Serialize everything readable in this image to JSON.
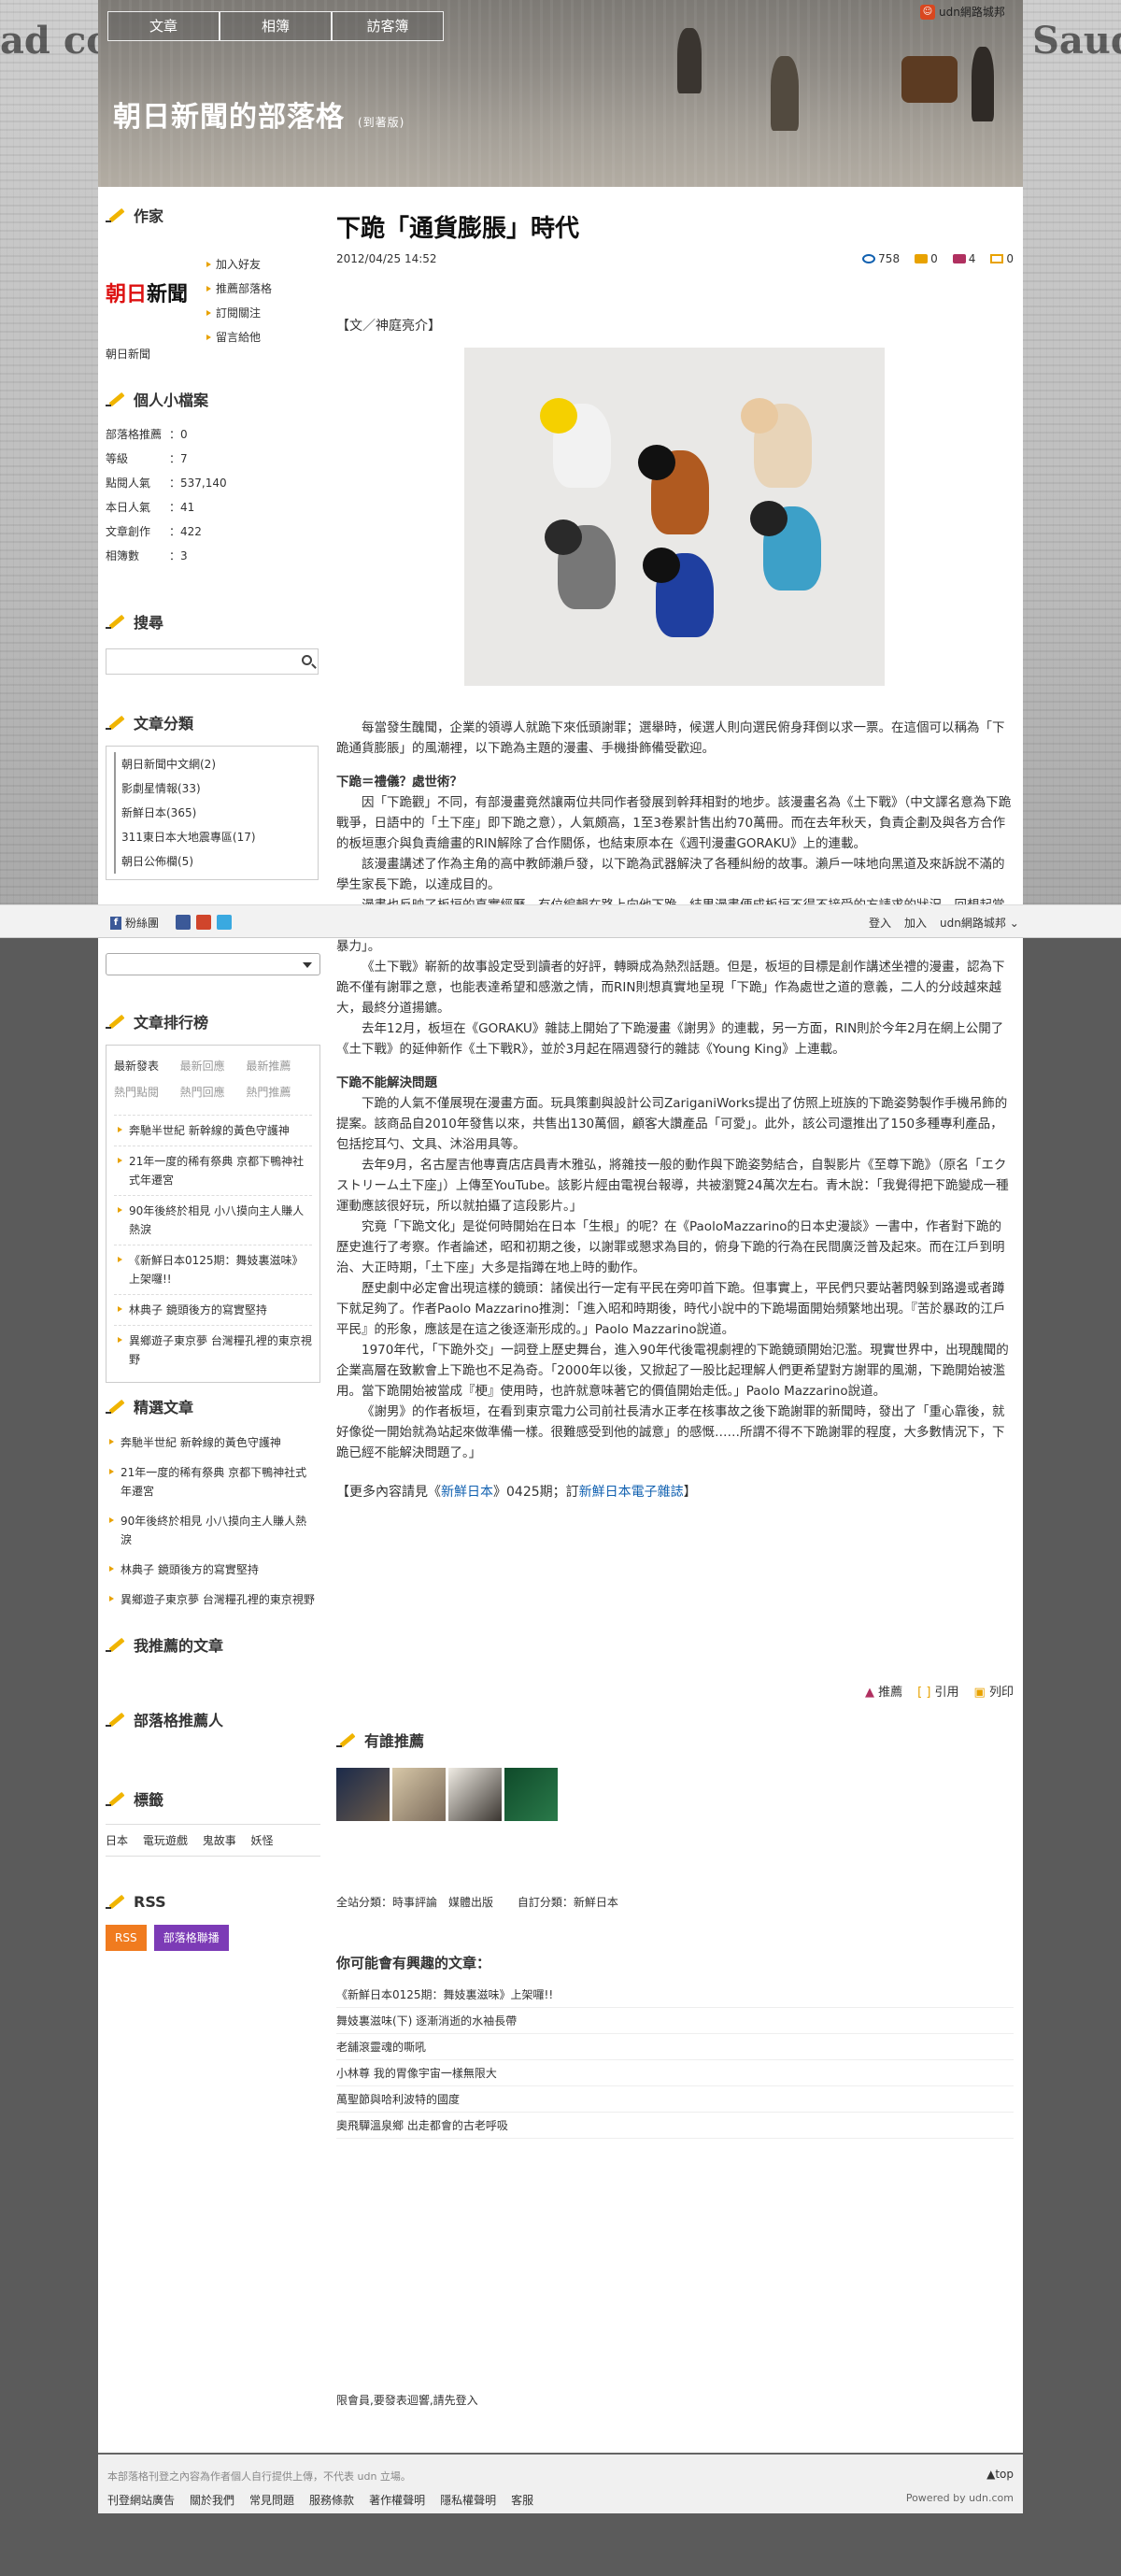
{
  "nav": {
    "tabs": [
      "文章",
      "相簿",
      "訪客簿"
    ]
  },
  "udn_link": "udn網路城邦",
  "blog": {
    "title": "朝日新聞的部落格",
    "badge": "(到著版)"
  },
  "author": {
    "section": "作家",
    "logo_red": "朝日",
    "logo_black": "新聞",
    "name": "朝日新聞",
    "links": [
      "加入好友",
      "推薦部落格",
      "訂閱關注",
      "留言給他"
    ]
  },
  "profile": {
    "section": "個人小檔案",
    "rows": [
      {
        "k": "部落格推薦",
        "v": "0"
      },
      {
        "k": "等級",
        "v": "7"
      },
      {
        "k": "點閱人氣",
        "v": "537,140"
      },
      {
        "k": "本日人氣",
        "v": "41"
      },
      {
        "k": "文章創作",
        "v": "422"
      },
      {
        "k": "相簿數",
        "v": "3"
      }
    ]
  },
  "search": {
    "section": "搜尋"
  },
  "categories": {
    "section": "文章分類",
    "items": [
      "朝日新聞中文網(2)",
      "影劇星情報(33)",
      "新鮮日本(365)",
      "311東日本大地震專區(17)",
      "朝日公佈欄(5)"
    ]
  },
  "ranking": {
    "section": "文章排行榜",
    "tabs_row1": [
      "最新發表",
      "最新回應",
      "最新推薦"
    ],
    "tabs_row2": [
      "熱門點閱",
      "熱門回應",
      "熱門推薦"
    ],
    "items": [
      "奔馳半世紀 新幹線的黃色守護神",
      "21年一度的稀有祭典 京都下鴨神社式年遷宮",
      "90年後終於相見 小八摸向主人賺人熱淚",
      "《新鮮日本0125期：舞妓裏滋味》上架囉!!",
      "林典子 鏡頭後方的寫實堅持",
      "異鄉遊子東京夢 台灣糧孔裡的東京視野"
    ]
  },
  "picks": {
    "section": "精選文章",
    "items": [
      "奔馳半世紀 新幹線的黃色守護神",
      "21年一度的稀有祭典 京都下鴨神社式年遷宮",
      "90年後終於相見 小八摸向主人賺人熱淚",
      "林典子 鏡頭後方的寫實堅持",
      "異鄉遊子東京夢 台灣糧孔裡的東京視野"
    ]
  },
  "my_reco": {
    "section": "我推薦的文章"
  },
  "blog_reco": {
    "section": "部落格推薦人"
  },
  "tags": {
    "section": "標籤",
    "items": [
      "日本",
      "電玩遊戲",
      "鬼故事",
      "妖怪"
    ]
  },
  "rss": {
    "section": "RSS",
    "btn1": "RSS",
    "btn2": "部落格聯播"
  },
  "post": {
    "title": "下跪「通貨膨脹」時代",
    "date": "2012/04/25 14:52",
    "views": "758",
    "comments": "0",
    "recommends": "4",
    "quotes": "0",
    "credit": "【文／神庭亮介】",
    "paragraphs": [
      {
        "type": "p",
        "text": "每當發生醜聞，企業的領導人就跪下來低頭謝罪；選舉時，候選人則向選民俯身拜倒以求一票。在這個可以稱為「下跪通貨膨脹」的風潮裡，以下跪為主題的漫畫、手機掛飾備受歡迎。"
      },
      {
        "type": "sub",
        "text": "下跪＝禮儀？處世術？"
      },
      {
        "type": "p",
        "text": "因「下跪觀」不同，有部漫畫竟然讓兩位共同作者發展到幹拜相對的地步。該漫畫名為《土下戰》（中文譯名意為下跪戰爭，日語中的「土下座」即下跪之意），人氣頗高，1至3卷累計售出約70萬冊。而在去年秋天，負責企劃及與各方合作的板垣惠介與負責繪畫的RIN解除了合作關係，也結束原本在《週刊漫畫GORAKU》上的連載。"
      },
      {
        "type": "p",
        "text": "該漫畫講述了作為主角的高中教師瀨戶發，以下跪為武器解決了各種糾紛的故事。瀨戶一味地向黑道及來訴說不滿的學生家長下跪，以達成目的。"
      },
      {
        "type": "p",
        "text": "漫畫也反映了板垣的真實經歷。有位編輯在路上向他下跪，結果漫畫便成板垣不得不接受的方請求的狀況。回想起當時的情景，板垣說：「周圍的人都用『哎呀你就答應他吧』的眼神看著我，其實真正受逼迫的是被下跪的我啊。下跪是一種暴力」。"
      },
      {
        "type": "p",
        "text": "《土下戰》嶄新的故事設定受到讀者的好評，轉瞬成為熱烈話題。但是，板垣的目標是創作講述坐禮的漫畫，認為下跪不僅有謝罪之意，也能表達希望和感激之情，而RIN則想真實地呈現「下跪」作為處世之道的意義，二人的分歧越來越大，最終分道揚鑣。"
      },
      {
        "type": "p",
        "text": "去年12月，板垣在《GORAKU》雜誌上開始了下跪漫畫《謝男》的連載，另一方面，RIN則於今年2月在網上公開了《土下戰》的延伸新作《土下戰R》，並於3月起在隔週發行的雜誌《Young King》上連載。"
      },
      {
        "type": "sub",
        "text": "下跪不能解決問題"
      },
      {
        "type": "p",
        "text": "下跪的人氣不僅展現在漫畫方面。玩具策劃與設計公司ZariganiWorks提出了仿照上班族的下跪姿勢製作手機吊飾的提案。該商品自2010年發售以來，共售出130萬個，顧客大讚產品「可愛」。此外，該公司還推出了150多種專利產品，包括挖耳勺、文具、沐浴用具等。"
      },
      {
        "type": "p",
        "text": "去年9月，名古屋吉他專賣店店員青木雅弘，將雜技一般的動作與下跪姿勢結合，自製影片《至尊下跪》（原名「エクストリーム土下座」）上傳至YouTube。該影片經由電視台報導，共被瀏覽24萬次左右。青木說：「我覺得把下跪變成一種運動應該很好玩，所以就拍攝了這段影片。」"
      },
      {
        "type": "p",
        "text": "究竟「下跪文化」是從何時開始在日本「生根」的呢？在《PaoloMazzarino的日本史漫談》一書中，作者對下跪的歷史進行了考察。作者論述，昭和初期之後，以謝罪或懇求為目的，俯身下跪的行為在民間廣泛普及起來。而在江戶到明治、大正時期，「土下座」大多是指蹲在地上時的動作。"
      },
      {
        "type": "p",
        "text": "歷史劇中必定會出現這樣的鏡頭：諸侯出行一定有平民在旁叩首下跪。但事實上，平民們只要站著閃躲到路邊或者蹲下就足夠了。作者Paolo Mazzarino推測：「進入昭和時期後，時代小說中的下跪場面開始頻繁地出現。『苦於暴政的江戶平民』的形象，應該是在這之後逐漸形成的。」Paolo Mazzarino說道。"
      },
      {
        "type": "p",
        "text": "1970年代，「下跪外交」一詞登上歷史舞台，進入90年代後電視劇裡的下跪鏡頭開始氾濫。現實世界中，出現醜聞的企業高層在致歉會上下跪也不足為奇。「2000年以後，又掀起了一股比起理解人們更希望對方謝罪的風潮，下跪開始被濫用。當下跪開始被當成『梗』使用時，也許就意味著它的價值開始走低。」Paolo Mazzarino說道。"
      },
      {
        "type": "p",
        "text": "《謝男》的作者板垣，在看到東京電力公司前社長清水正孝在核事故之後下跪謝罪的新聞時，發出了「重心靠後，就好像從一開始就為站起來做準備一樣。很難感受到他的誠意」的感慨……所謂不得不下跪謝罪的程度，大多數情況下，下跪已經不能解決問題了。」"
      }
    ],
    "more_prefix": "【更多內容請見《",
    "more_link1": "新鮮日本",
    "more_mid": "》0425期；訂",
    "more_link2": "新鮮日本電子雜誌",
    "more_suffix": "】",
    "action_reco": "推薦",
    "action_quote": "引用",
    "action_print": "列印"
  },
  "who_reco": {
    "title": "有誰推薦"
  },
  "meta": {
    "site_cat": "全站分類：時事評論　媒體出版",
    "custom_cat": "自訂分類：新鮮日本"
  },
  "interest": {
    "title": "你可能會有興趣的文章：",
    "items": [
      "《新鮮日本0125期：舞妓裏滋味》上架囉!!",
      "舞妓裏滋味(下) 逐漸消逝的水袖長帶",
      "老舖滾靈魂的嘶吼",
      "小林尊 我的胃像宇宙一樣無限大",
      "萬聖節與哈利波特的國度",
      "奧飛驒溫泉鄉 出走都會的古老呼吸"
    ]
  },
  "login_note": "限會員,要發表迴響,請先登入",
  "toolbar": {
    "fans": "粉絲團",
    "login": "登入",
    "join": "加入",
    "city": "udn網路城邦"
  },
  "footer": {
    "note": "本部落格刊登之內容為作者個人自行提供上傳，不代表 udn 立場。",
    "links": [
      "刊登網站廣告",
      "關於我們",
      "常見問題",
      "服務條款",
      "著作權聲明",
      "隱私權聲明",
      "客服"
    ],
    "top": "▲top",
    "powered": "Powered by udn.com"
  },
  "colors": {
    "accent": "#e8a200",
    "link": "#1060b0",
    "rss": "#f07b1f",
    "blogfeed": "#7c3bb6"
  }
}
